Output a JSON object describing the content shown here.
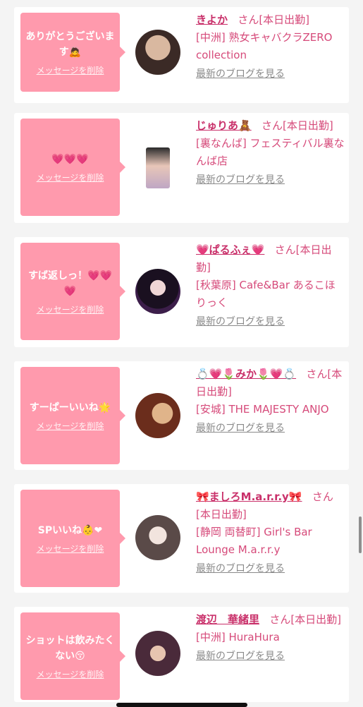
{
  "delete_label": "メッセージを削除",
  "blog_label": "最新のブログを見る",
  "colors": {
    "bubble": "#ff9aad",
    "name": "#c9306a",
    "text": "#d64a7a",
    "link_gray": "#8a8a8a"
  },
  "items": [
    {
      "message": "ありがとうございます🙇",
      "name": "きよか",
      "suffix": "さん[本日出勤]",
      "shop": "[中洲] 熟女キャバクラZERO collection"
    },
    {
      "message": "💗💗💗",
      "name": "じゅりあ🧸",
      "suffix": "さん[本日出勤]",
      "shop": "[裏なんば] フェスティバル裏なんば店"
    },
    {
      "message": "すば返しっ！💗💗💗",
      "name": "💗ぱるふぇ💗",
      "suffix": "さん[本日出勤]",
      "shop": "[秋葉原] Cafe&Bar あるこほりっく"
    },
    {
      "message": "すーぱーいいね🌟",
      "name": "💍💗🌷みか🌷💗💍",
      "suffix": "さん[本日出勤]",
      "shop": "[安城] THE MAJESTY ANJO"
    },
    {
      "message": "SPいいね👶❤",
      "name": "🎀ましろM.a.r.r.y🎀",
      "suffix": "さん[本日出勤]",
      "shop": "[静岡 両替町] Girl's Bar Lounge M.a.r.r.y"
    },
    {
      "message": "ショットは飲みたくない😚",
      "name": "渡辺　華緒里",
      "suffix": "さん[本日出勤]",
      "shop": "[中洲] HuraHura"
    }
  ]
}
